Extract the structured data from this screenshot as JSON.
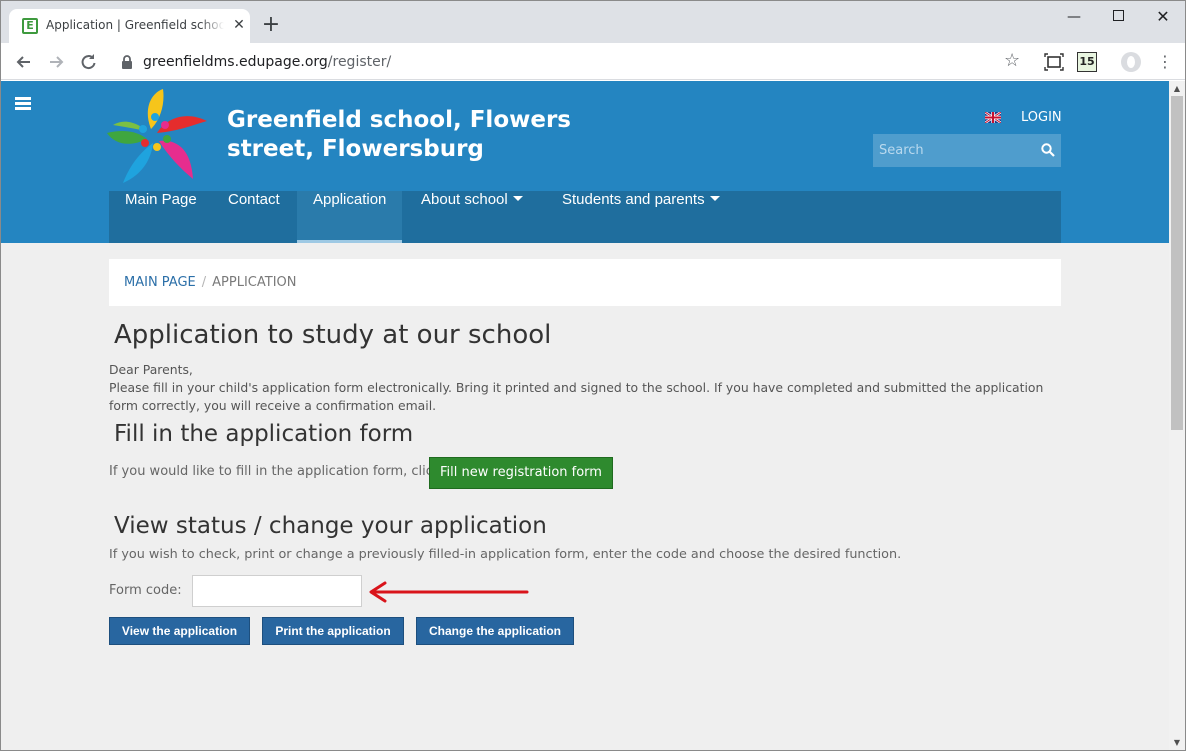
{
  "browser": {
    "tab_title": "Application | Greenfield school, Flowers street, Flowersburg",
    "tab_favicon_letter": "E",
    "new_tab": "+",
    "url_domain": "greenfieldms.edupage.org",
    "url_path": "/register/",
    "calendar_ext": "15",
    "minimize": "—",
    "close": "✕"
  },
  "header": {
    "school_name": "Greenfield school, Flowers street, Flowersburg",
    "login": "LOGIN",
    "search_placeholder": "Search"
  },
  "nav": {
    "items": [
      {
        "label": "Main Page"
      },
      {
        "label": "Contact"
      },
      {
        "label": "Application"
      },
      {
        "label": "About school"
      },
      {
        "label": "Students and parents"
      }
    ],
    "active_index": 2
  },
  "breadcrumb": {
    "home": "MAIN PAGE",
    "separator": "/",
    "current": "APPLICATION"
  },
  "content": {
    "title": "Application to study at our school",
    "intro_greeting": "Dear Parents,",
    "intro_text": "Please fill in your child's application form electronically. Bring it printed and signed to the school. If you have completed and submitted the application form correctly, you will receive a confirmation email.",
    "fill_heading": "Fill in the application form",
    "fill_text": "If you would like to fill in the application form, click:",
    "fill_button": "Fill new registration form",
    "status_heading": "View status / change your application",
    "status_text": "If you wish to check, print or change a previously filled-in application form, enter the code and choose the desired function.",
    "form_code_label": "Form code:",
    "form_code_value": "",
    "view_button": "View the application",
    "print_button": "Print the application",
    "change_button": "Change the application"
  },
  "colors": {
    "header_blue": "#2485c1",
    "nav_blue": "#1f6e9e",
    "green_button": "#2e8a2e",
    "blue_button": "#2866a0",
    "annotation_arrow": "#d9141b"
  }
}
